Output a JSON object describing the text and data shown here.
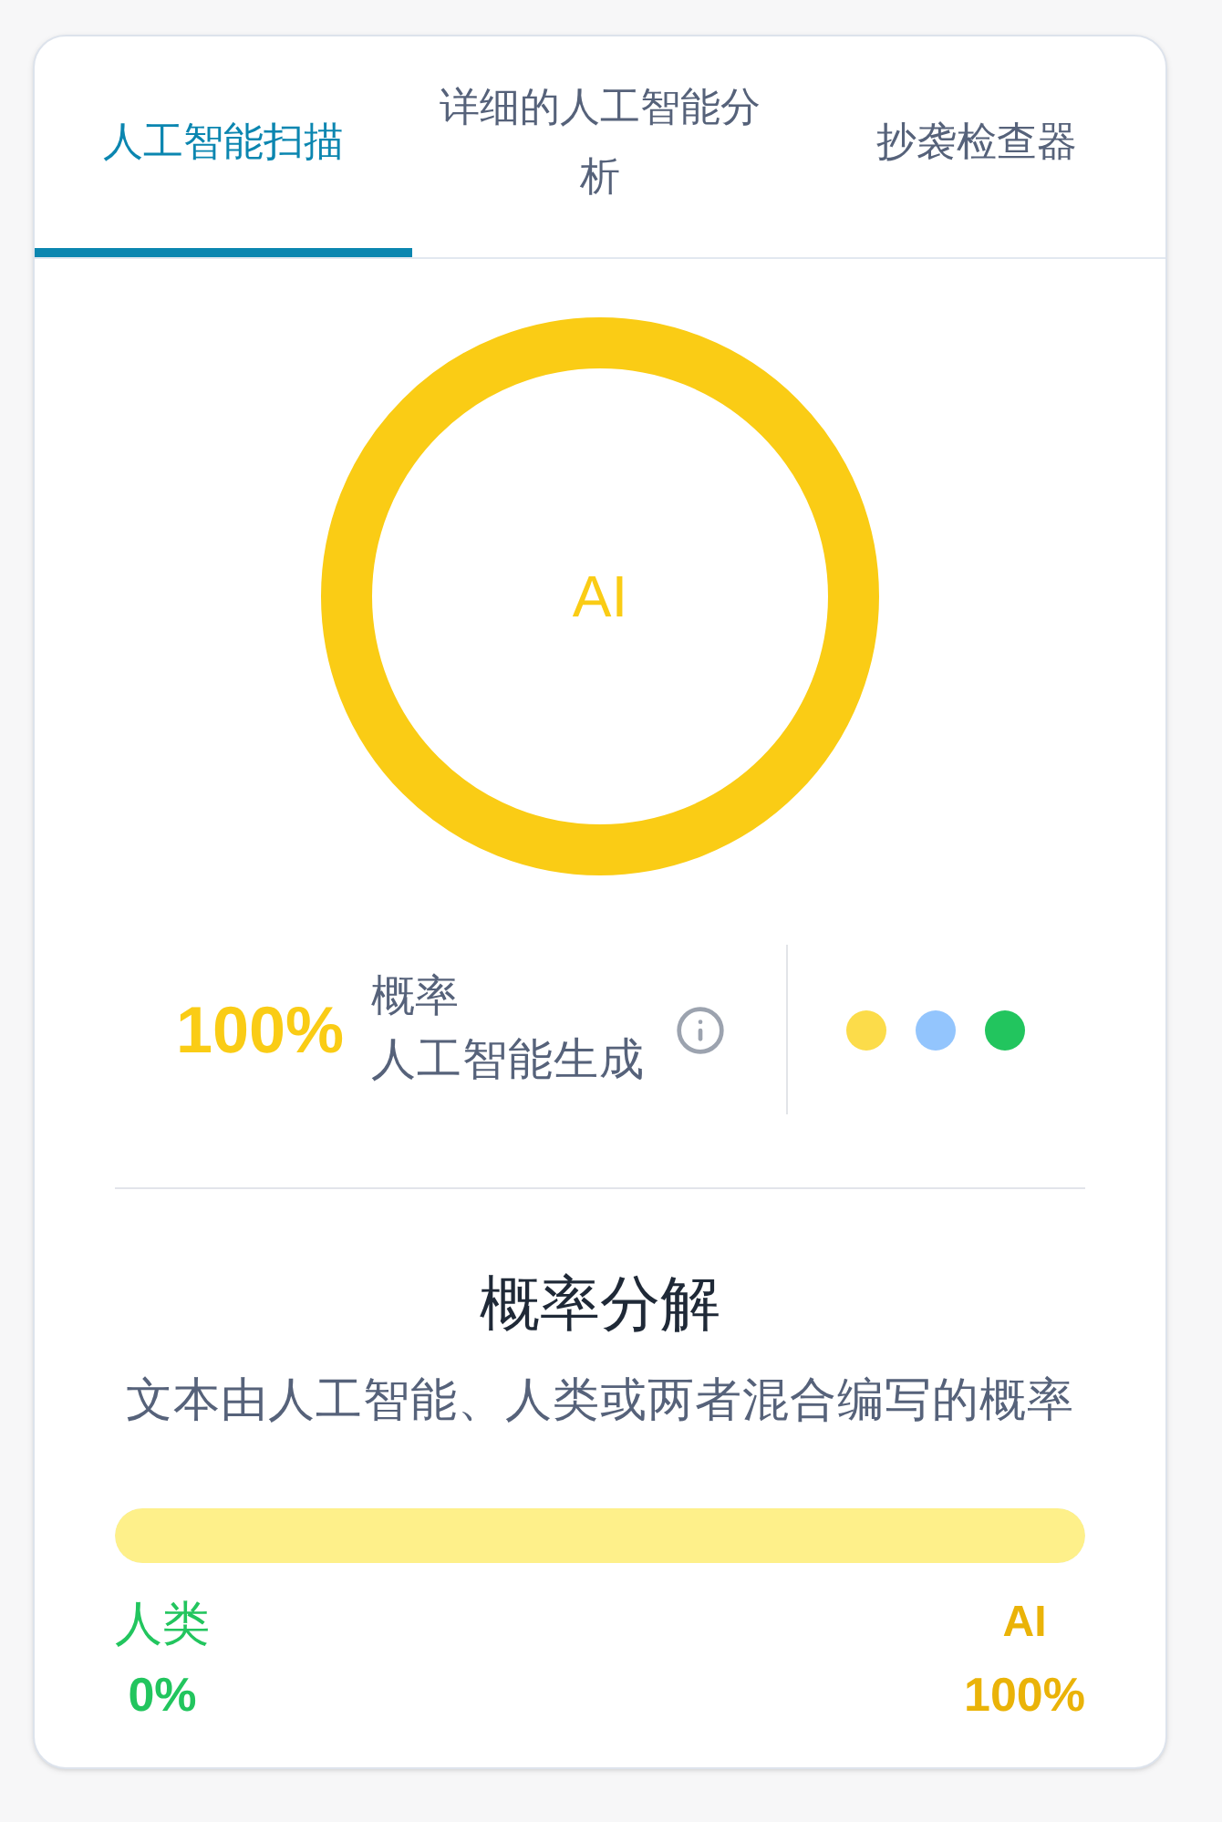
{
  "tabs": [
    {
      "label": "人工智能扫描",
      "selected": true
    },
    {
      "label": "详细的人工智能分析",
      "selected": false
    },
    {
      "label": "抄袭检查器",
      "selected": false
    }
  ],
  "donut": {
    "center_label": "AI"
  },
  "result": {
    "percent": "100%",
    "caption": "概率",
    "label": "人工智能生成"
  },
  "legend_dots": [
    {
      "color": "#fcdc4a"
    },
    {
      "color": "#93c5fd"
    },
    {
      "color": "#22c55e"
    }
  ],
  "breakdown": {
    "title": "概率分解",
    "subtitle": "文本由人工智能、人类或两者混合编写的概率",
    "bar": {
      "level": 1
    },
    "human": {
      "label": "人类",
      "value": "0%"
    },
    "ai": {
      "label": "AI",
      "value": "100%"
    }
  }
}
